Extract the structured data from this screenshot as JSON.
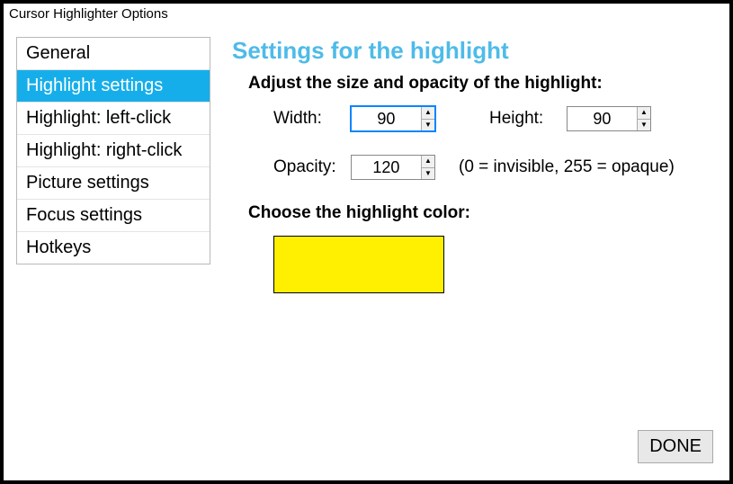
{
  "window": {
    "title": "Cursor Highlighter Options"
  },
  "sidebar": {
    "items": [
      {
        "label": "General"
      },
      {
        "label": "Highlight settings"
      },
      {
        "label": "Highlight: left-click"
      },
      {
        "label": "Highlight: right-click"
      },
      {
        "label": "Picture settings"
      },
      {
        "label": "Focus settings"
      },
      {
        "label": "Hotkeys"
      }
    ],
    "selected_index": 1
  },
  "main": {
    "page_title": "Settings for the highlight",
    "size_heading": "Adjust the size and opacity of the highlight:",
    "width_label": "Width:",
    "width_value": "90",
    "height_label": "Height:",
    "height_value": "90",
    "opacity_label": "Opacity:",
    "opacity_value": "120",
    "opacity_hint": "(0 = invisible, 255 = opaque)",
    "color_heading": "Choose the highlight color:",
    "highlight_color": "#ffef00"
  },
  "footer": {
    "done_label": "DONE"
  }
}
